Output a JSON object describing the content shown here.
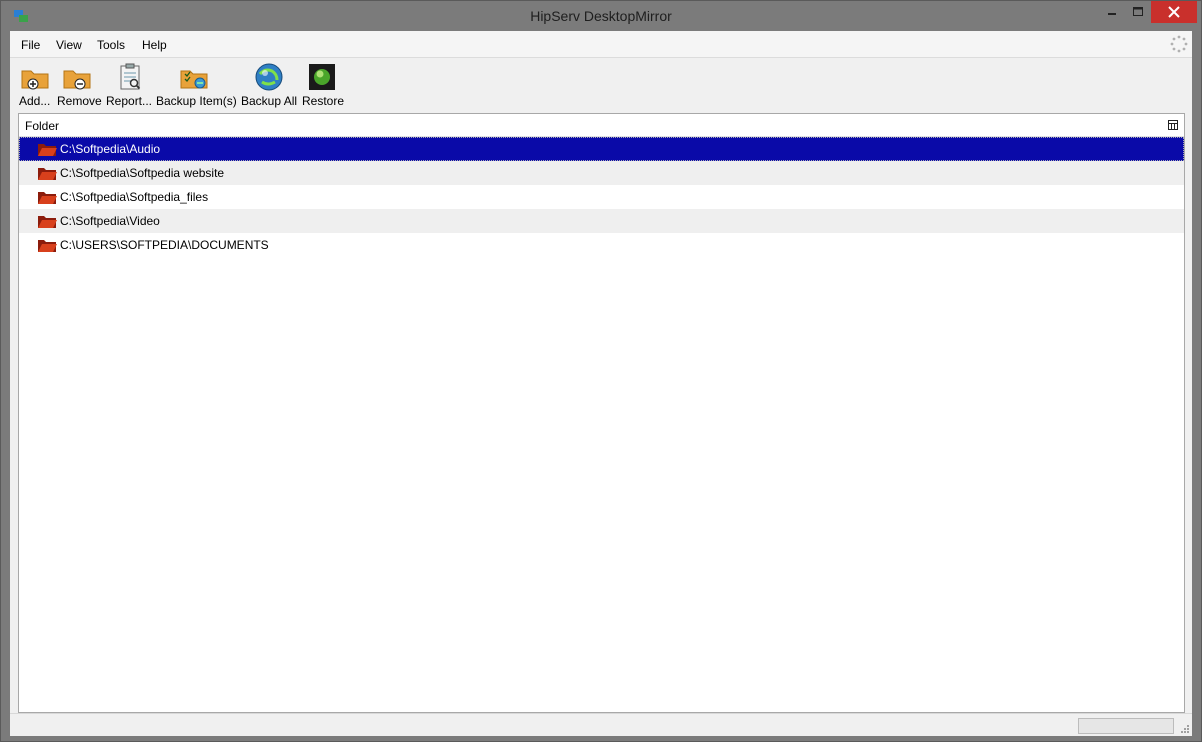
{
  "window": {
    "title": "HipServ DesktopMirror"
  },
  "menu": {
    "items": [
      {
        "label": "File"
      },
      {
        "label": "View"
      },
      {
        "label": "Tools"
      },
      {
        "label": "Help"
      }
    ]
  },
  "toolbar": {
    "buttons": [
      {
        "label": "Add...",
        "icon": "add-folder-icon"
      },
      {
        "label": "Remove",
        "icon": "remove-folder-icon"
      },
      {
        "label": "Report...",
        "icon": "report-icon"
      },
      {
        "label": "Backup Item(s)",
        "icon": "backup-items-icon"
      },
      {
        "label": "Backup All",
        "icon": "backup-all-icon"
      },
      {
        "label": "Restore",
        "icon": "restore-icon"
      }
    ]
  },
  "list": {
    "column_header": "Folder",
    "rows": [
      {
        "path": "C:\\Softpedia\\Audio",
        "selected": true
      },
      {
        "path": "C:\\Softpedia\\Softpedia website"
      },
      {
        "path": "C:\\Softpedia\\Softpedia_files"
      },
      {
        "path": "C:\\Softpedia\\Video"
      },
      {
        "path": "C:\\USERS\\SOFTPEDIA\\DOCUMENTS"
      }
    ]
  },
  "colors": {
    "selection": "#0a0aa8",
    "close_button": "#c9302c",
    "folder": "#c0361c"
  }
}
